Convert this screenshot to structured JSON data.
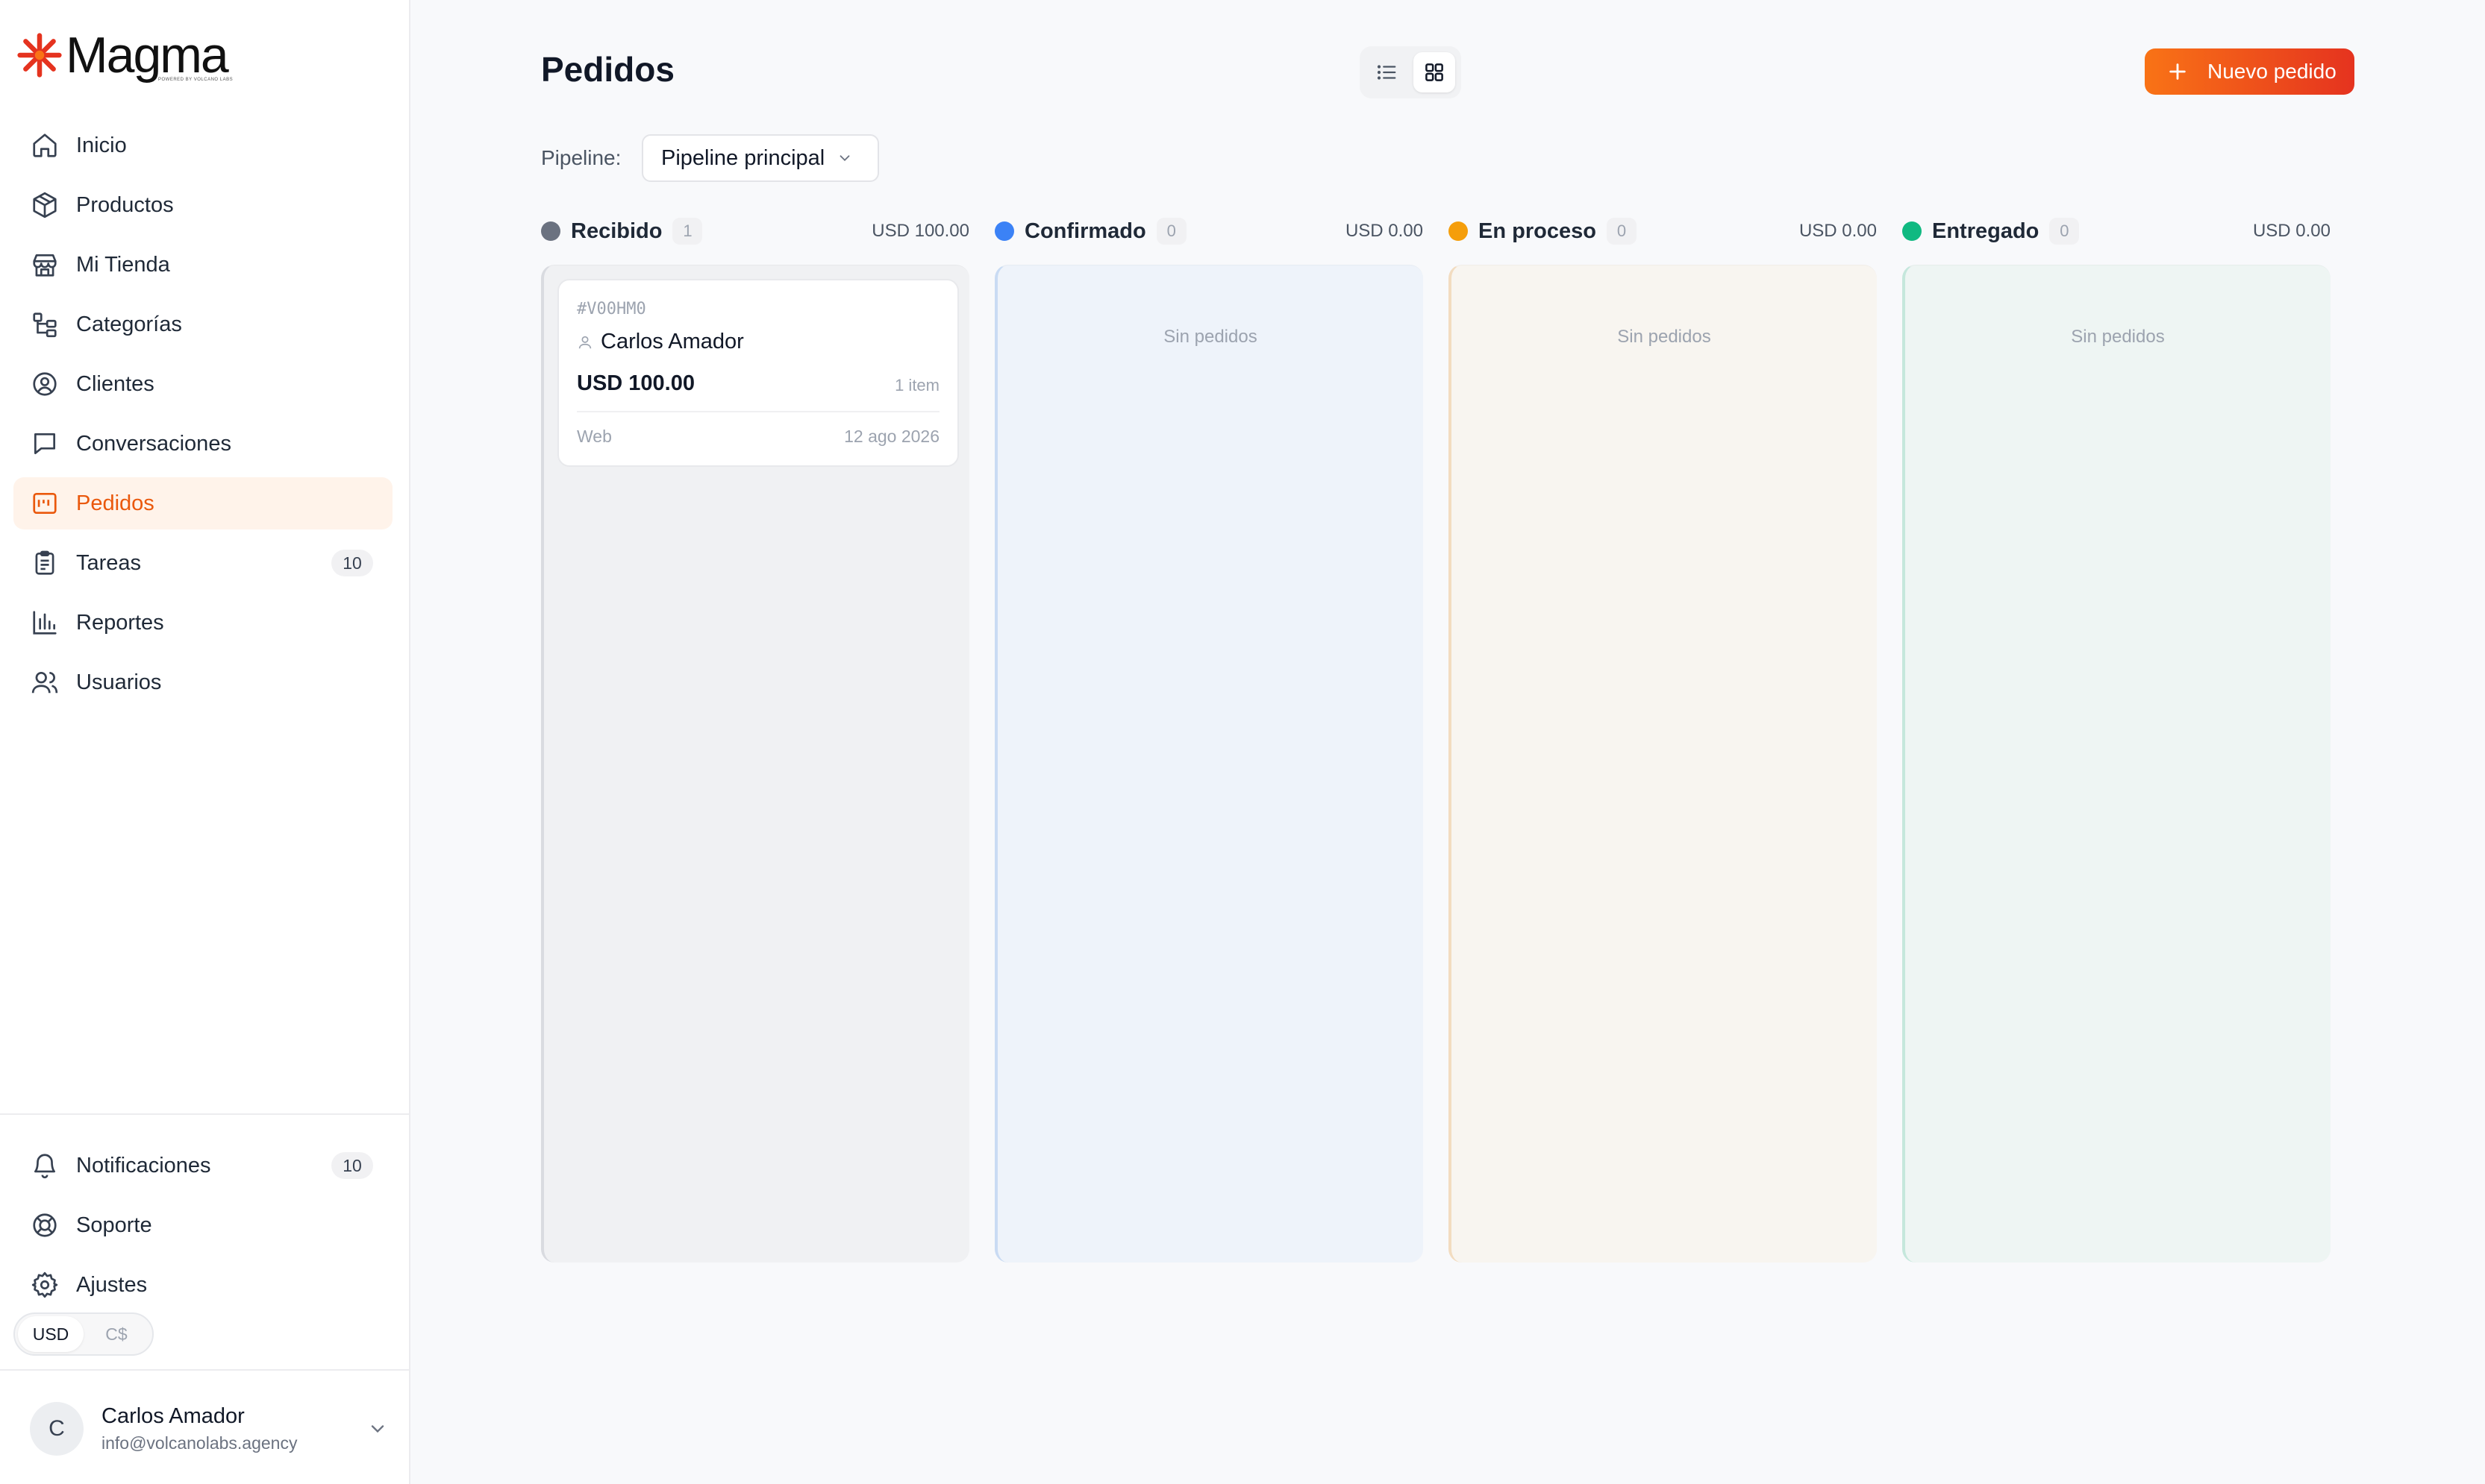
{
  "brand": {
    "name": "Magma",
    "tagline": "POWERED BY VOLCANO LABS",
    "accent": "#ea580c"
  },
  "sidebar": {
    "items": [
      {
        "label": "Inicio",
        "icon": "home-icon"
      },
      {
        "label": "Productos",
        "icon": "box-icon"
      },
      {
        "label": "Mi Tienda",
        "icon": "store-icon"
      },
      {
        "label": "Categorías",
        "icon": "hierarchy-icon"
      },
      {
        "label": "Clientes",
        "icon": "user-circle-icon"
      },
      {
        "label": "Conversaciones",
        "icon": "chat-icon"
      },
      {
        "label": "Pedidos",
        "icon": "orders-icon",
        "active": true
      },
      {
        "label": "Tareas",
        "icon": "clipboard-icon",
        "badge": "10"
      },
      {
        "label": "Reportes",
        "icon": "bar-chart-icon"
      },
      {
        "label": "Usuarios",
        "icon": "users-icon"
      }
    ],
    "bottom_items": [
      {
        "label": "Notificaciones",
        "icon": "bell-icon",
        "badge": "10"
      },
      {
        "label": "Soporte",
        "icon": "lifebuoy-icon"
      },
      {
        "label": "Ajustes",
        "icon": "gear-icon"
      }
    ],
    "currency": {
      "options": [
        "USD",
        "C$"
      ],
      "selected": "USD"
    },
    "user": {
      "initial": "C",
      "name": "Carlos Amador",
      "email": "info@volcanolabs.agency"
    }
  },
  "header": {
    "title": "Pedidos",
    "new_button": "Nuevo pedido",
    "view_modes": [
      "list",
      "board"
    ],
    "active_view": "board"
  },
  "pipeline": {
    "label": "Pipeline:",
    "selected": "Pipeline principal"
  },
  "columns": [
    {
      "title": "Recibido",
      "count": "1",
      "total": "USD 100.00",
      "color": "#6b7280",
      "bg": "#f0f1f3",
      "border": "#d9dbe0"
    },
    {
      "title": "Confirmado",
      "count": "0",
      "total": "USD 0.00",
      "color": "#3b82f6",
      "bg": "#eef3fa",
      "border": "#c9dbf3",
      "empty": "Sin pedidos"
    },
    {
      "title": "En proceso",
      "count": "0",
      "total": "USD 0.00",
      "color": "#f59e0b",
      "bg": "#f8f5f0",
      "border": "#f2dcc0",
      "empty": "Sin pedidos"
    },
    {
      "title": "Entregado",
      "count": "0",
      "total": "USD 0.00",
      "color": "#10b981",
      "bg": "#eef5f3",
      "border": "#c5e7dc",
      "empty": "Sin pedidos"
    }
  ],
  "orders": [
    {
      "id": "#V00HM0",
      "customer": "Carlos Amador",
      "amount": "USD 100.00",
      "items": "1 item",
      "channel": "Web",
      "date": "12 ago 2026"
    }
  ]
}
